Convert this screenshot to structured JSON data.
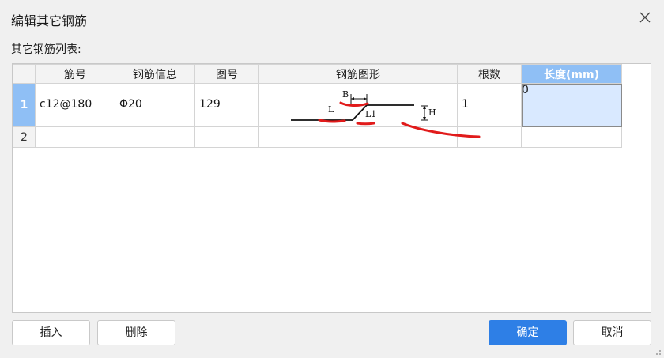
{
  "dialog": {
    "title": "编辑其它钢筋",
    "list_label": "其它钢筋列表:"
  },
  "table": {
    "columns": [
      "筋号",
      "钢筋信息",
      "图号",
      "钢筋图形",
      "根数",
      "长度(mm)"
    ],
    "active_column": "长度(mm)",
    "rows": [
      {
        "num": "1",
        "jinhao": "c12@180",
        "info": "Φ20",
        "tuhao": "129",
        "shape": "rebar-shape-diagram",
        "count": "1",
        "length": "0"
      },
      {
        "num": "2",
        "jinhao": "",
        "info": "",
        "tuhao": "",
        "shape": "",
        "count": "",
        "length": ""
      }
    ],
    "shape_labels": {
      "b": "B",
      "l": "L",
      "l1": "L1",
      "h": "H"
    }
  },
  "buttons": {
    "insert": "插入",
    "delete": "删除",
    "ok": "确定",
    "cancel": "取消"
  },
  "colors": {
    "primary": "#2e7fe6",
    "header_active": "#8fbff5",
    "selected_cell": "#d9e9ff",
    "annotation": "#e11b1b"
  },
  "icons": [
    "close-icon",
    "resize-grip-icon"
  ]
}
